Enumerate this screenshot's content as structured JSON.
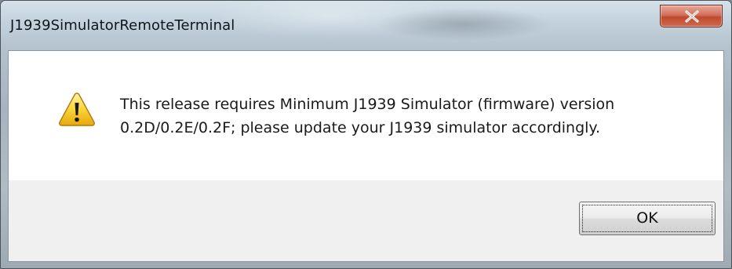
{
  "window": {
    "title": "J1939SimulatorRemoteTerminal"
  },
  "dialog": {
    "icon": "warning-icon",
    "message_line1": "This release requires Minimum J1939 Simulator (firmware) version",
    "message_line2": "0.2D/0.2E/0.2F; please update your J1939 simulator accordingly.",
    "ok_label": "OK"
  },
  "titlebar": {
    "close_icon": "close-icon",
    "close_color": "#c8503a"
  }
}
